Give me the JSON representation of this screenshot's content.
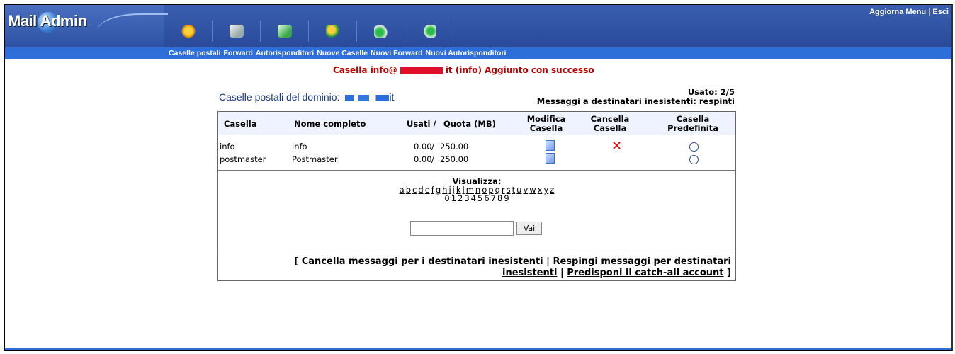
{
  "header": {
    "logo_text": "Mail Admin",
    "top_links": {
      "refresh": "Aggiorna Menu",
      "sep": " | ",
      "logout": "Esci"
    }
  },
  "toolbar": {
    "icons": [
      {
        "name": "mailboxes-icon",
        "label": "Caselle postali"
      },
      {
        "name": "forward-icon",
        "label": "Forward"
      },
      {
        "name": "autoresponders-icon",
        "label": "Autorisponditori"
      },
      {
        "name": "new-mailbox-icon",
        "label": "Nuove Caselle"
      },
      {
        "name": "new-forward-icon",
        "label": "Nuovi Forward"
      },
      {
        "name": "new-autoresponder-icon",
        "label": "Nuovi Autorisponditori"
      }
    ]
  },
  "message": {
    "pre": "Casella info@",
    "post": "it (info) Aggiunto con successo"
  },
  "domain": {
    "title": "Caselle postali del dominio:",
    "suffix": "it"
  },
  "usage": {
    "used": "Usato: 2/5",
    "policy": "Messaggi a destinatari inesistenti: respinti"
  },
  "table": {
    "headers": [
      "Casella",
      "Nome completo",
      "Usati /",
      "Quota (MB)",
      "Modifica Casella",
      "Cancella Casella",
      "Casella Predefinita"
    ],
    "rows": [
      {
        "mailbox": "info",
        "name": "info",
        "used": "0.00",
        "quota": "250.00"
      },
      {
        "mailbox": "postmaster",
        "name": "Postmaster",
        "used": "0.00",
        "quota": "250.00"
      }
    ]
  },
  "filter": {
    "label": "Visualizza:",
    "letters": [
      "a",
      "b",
      "c",
      "d",
      "e",
      "f",
      "g",
      "h",
      "i",
      "j",
      "k",
      "l",
      "m",
      "n",
      "o",
      "p",
      "q",
      "r",
      "s",
      "t",
      "u",
      "v",
      "w",
      "x",
      "y",
      "z"
    ],
    "digits": [
      "0",
      "1",
      "2",
      "3",
      "4",
      "5",
      "6",
      "7",
      "8",
      "9"
    ],
    "search_value": "",
    "go_label": "Vai"
  },
  "actions": {
    "open": "[",
    "clear_link": "Cancella messaggi per i destinatari inesistenti",
    "sep": "|",
    "reject_link": "Respingi messaggi per destinatari inesistenti",
    "catchall_link": "Predisponi il catch-all account",
    "close": "]"
  }
}
